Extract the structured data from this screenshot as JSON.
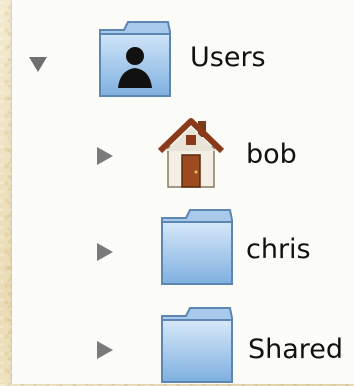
{
  "tree": {
    "items": [
      {
        "label": "Users",
        "icon": "user-folder-icon",
        "expanded": true
      },
      {
        "label": "bob",
        "icon": "home-icon",
        "expanded": false
      },
      {
        "label": "chris",
        "icon": "folder-icon",
        "expanded": false
      },
      {
        "label": "Shared",
        "icon": "folder-icon",
        "expanded": false
      }
    ]
  },
  "colors": {
    "background": "#f1e6c6",
    "panel": "#fbfbf8",
    "folder_blue": "#8fbde8",
    "triangle_gray": "#7a7a7a"
  }
}
